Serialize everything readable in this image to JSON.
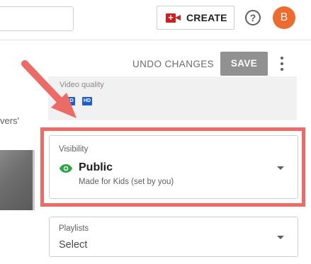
{
  "header": {
    "create_label": "CREATE",
    "help_glyph": "?",
    "avatar_initial": "B",
    "avatar_color": "#ec6b2d",
    "icons": [
      "video-camera-plus-icon",
      "help-circle-icon"
    ]
  },
  "toolbar": {
    "undo_label": "UNDO CHANGES",
    "save_label": "SAVE",
    "more_icon": "vertical-ellipsis-icon"
  },
  "left_column": {
    "partial_text": "vers'"
  },
  "video_quality": {
    "label": "Video quality",
    "badges": [
      "SD",
      "HD"
    ],
    "badge_color": "#1e5ec9"
  },
  "visibility": {
    "label": "Visibility",
    "value": "Public",
    "sub_text": "Made for Kids (set by you)",
    "icon": "eye-icon",
    "icon_color": "#2ba640",
    "highlight_color": "#ec6b66"
  },
  "playlists": {
    "label": "Playlists",
    "value": "Select"
  }
}
